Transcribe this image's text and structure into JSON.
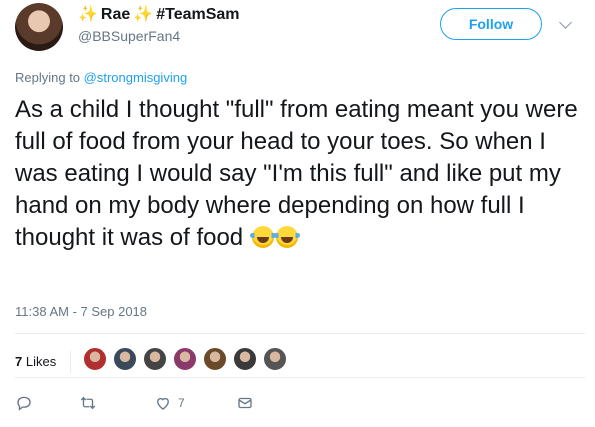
{
  "user": {
    "display_name": "Rae",
    "team_tag": "#TeamSam",
    "handle": "@BBSuperFan4",
    "name_emoji": "sparkles-icon"
  },
  "header": {
    "follow_label": "Follow",
    "more_icon": "chevron-down-icon"
  },
  "reply": {
    "prefix": "Replying to ",
    "mention": "@strongmisgiving"
  },
  "tweet": {
    "text": "As a child I thought \"full\" from eating meant you were full of food from your head to your toes. So when I was eating I would say \"I'm this full\" and like put my hand on my body where depending on how full I thought it was of food",
    "trailing_emoji": [
      "face-with-tears-of-joy-icon",
      "face-with-tears-of-joy-icon"
    ],
    "timestamp": "11:38 AM - 7 Sep 2018"
  },
  "stats": {
    "likes_count": "7",
    "likes_label": " Likes",
    "liker_avatars": [
      "#b03030",
      "#3a4a5a",
      "#444444",
      "#8a3a6a",
      "#6a4a2a",
      "#3a3a3a",
      "#555555"
    ]
  },
  "actions": {
    "reply_icon": "reply-icon",
    "retweet_icon": "retweet-icon",
    "like_icon": "heart-icon",
    "like_count": "7",
    "dm_icon": "envelope-icon"
  },
  "colors": {
    "accent": "#1da1f2",
    "muted": "#657786",
    "text": "#14171a",
    "divider": "#e6ecf0"
  }
}
